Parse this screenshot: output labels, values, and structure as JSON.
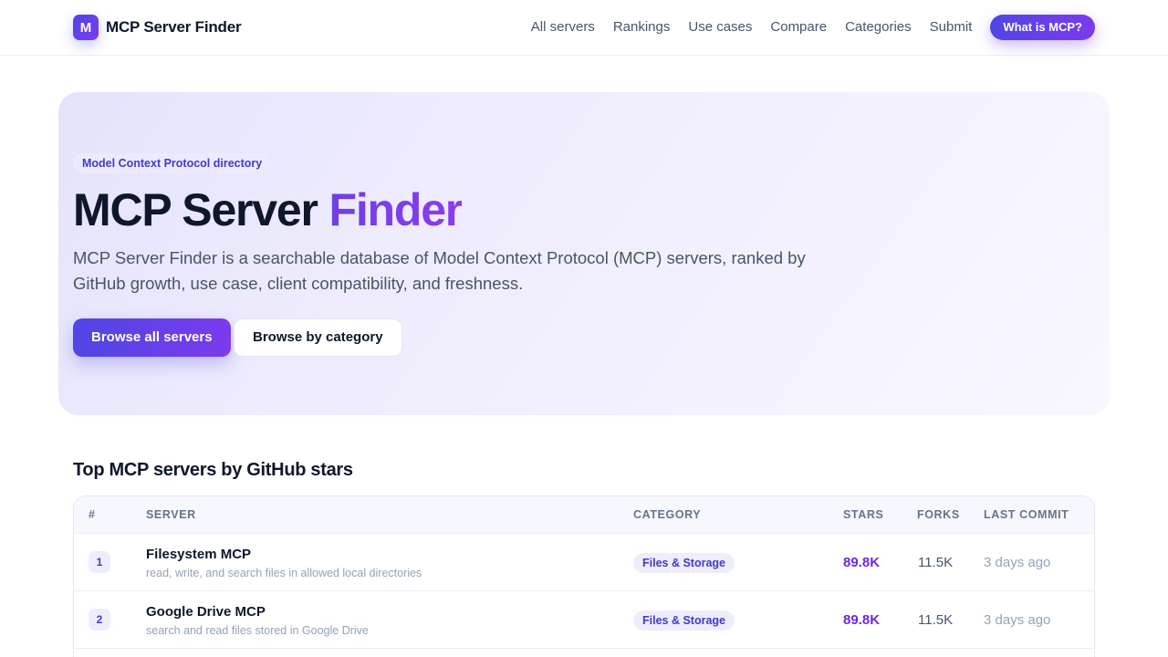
{
  "header": {
    "brand_mark": "M",
    "brand_name": "MCP Server Finder",
    "nav": [
      "All servers",
      "Rankings",
      "Use cases",
      "Compare",
      "Categories",
      "Submit"
    ],
    "cta": "What is MCP?"
  },
  "hero": {
    "eyebrow": "Model Context Protocol directory",
    "title_main": "MCP Server ",
    "title_accent": "Finder",
    "description": "MCP Server Finder is a searchable database of Model Context Protocol (MCP) servers, ranked by GitHub growth, use case, client compatibility, and freshness.",
    "primary_button": "Browse all servers",
    "secondary_button": "Browse by category"
  },
  "rankings": {
    "title": "Top MCP servers by GitHub stars",
    "columns": {
      "rank": "#",
      "server": "SERVER",
      "category": "CATEGORY",
      "stars": "STARS",
      "forks": "FORKS",
      "last_commit": "LAST COMMIT"
    },
    "rows": [
      {
        "rank": "1",
        "name": "Filesystem MCP",
        "description": "read, write, and search files in allowed local directories",
        "category": "Files & Storage",
        "stars": "89.8K",
        "forks": "11.5K",
        "last_commit": "3 days ago"
      },
      {
        "rank": "2",
        "name": "Google Drive MCP",
        "description": "search and read files stored in Google Drive",
        "category": "Files & Storage",
        "stars": "89.8K",
        "forks": "11.5K",
        "last_commit": "3 days ago"
      }
    ]
  },
  "colors": {
    "accent_start": "#4f46e5",
    "accent_end": "#7c3aed",
    "stars": "#6d28d9",
    "text": "#0f172a",
    "muted": "#94a3b8"
  }
}
